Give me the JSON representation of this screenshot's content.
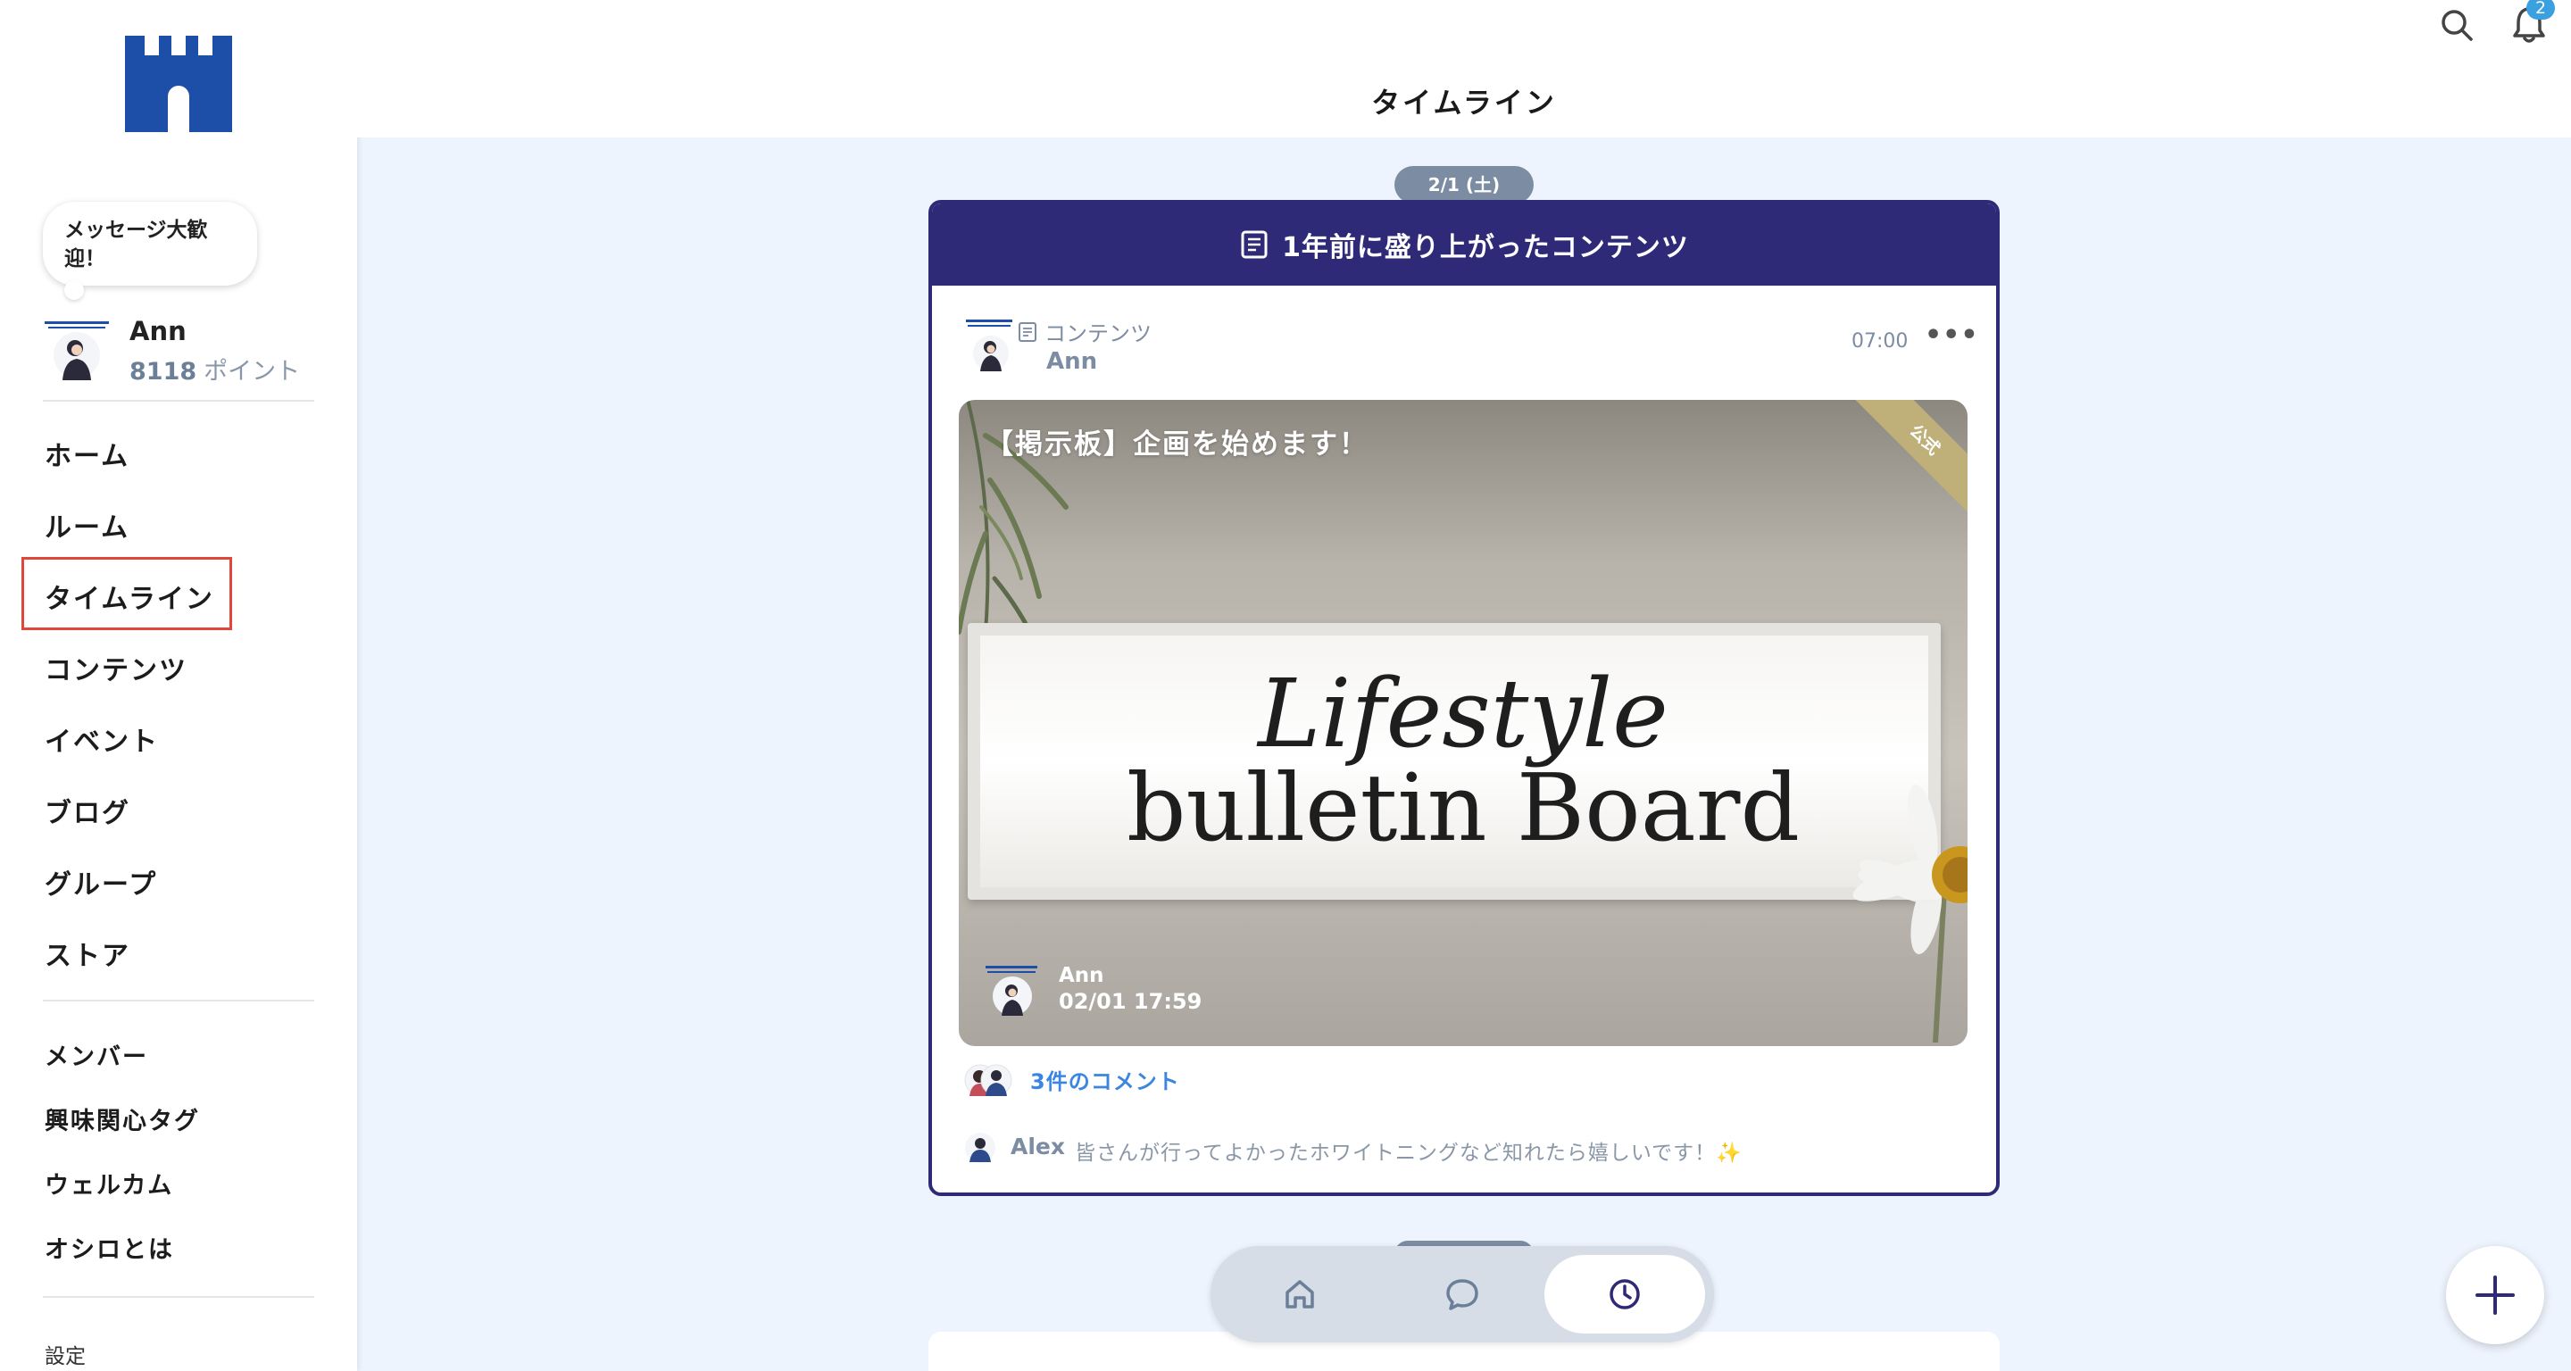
{
  "sidebar": {
    "bubble_text": "メッセージ大歓迎！",
    "user_name": "Ann",
    "points_value": "8118",
    "points_unit": "ポイント",
    "main_nav": [
      "ホーム",
      "ルーム",
      "タイムライン",
      "コンテンツ",
      "イベント",
      "ブログ",
      "グループ",
      "ストア"
    ],
    "sub_nav": [
      "メンバー",
      "興味関心タグ",
      "ウェルカム",
      "オシロとは"
    ],
    "settings_label": "設定",
    "active_item": "タイムライン"
  },
  "header": {
    "title": "タイムライン",
    "notification_count": "2"
  },
  "timeline": {
    "date_label": "2/1 (土)",
    "card": {
      "banner": "1年前に盛り上がったコンテンツ",
      "post_type": "コンテンツ",
      "author": "Ann",
      "time": "07:00",
      "more": "•••",
      "thumbnail": {
        "title": "【掲示板】企画を始めます！",
        "line1": "Lifestyle",
        "line2": "bulletin Board",
        "ribbon": "公式",
        "author": "Ann",
        "datetime": "02/01 17:59"
      },
      "comment_count": "3件のコメント",
      "latest_comment": {
        "name": "Alex",
        "text": "皆さんが行ってよかったホワイトニングなど知れたら嬉しいです！✨"
      }
    }
  },
  "bottom_nav": {
    "items": [
      "home-icon",
      "chat-icon",
      "clock-icon"
    ],
    "active": "clock-icon"
  },
  "colors": {
    "brand": "#1e4fa8",
    "banner": "#2e2a78",
    "background": "#eef4fd",
    "link": "#3a86e0",
    "highlight": "#e0473a"
  }
}
